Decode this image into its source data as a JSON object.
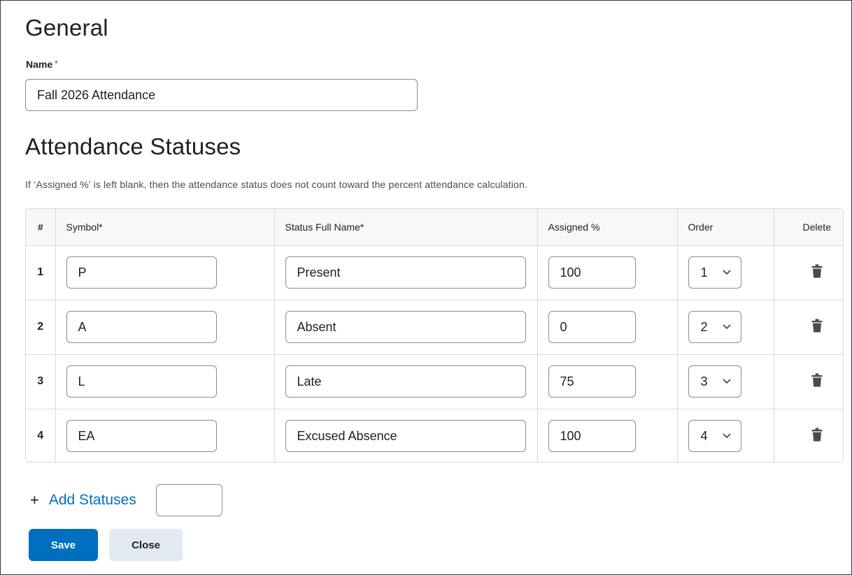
{
  "general": {
    "title": "General",
    "name_label": "Name",
    "required_mark": "*",
    "name_value": "Fall 2026 Attendance"
  },
  "statuses": {
    "title": "Attendance Statuses",
    "help_text": "If ‘Assigned %’ is left blank, then the attendance status does not count toward the percent attendance calculation.",
    "columns": {
      "num": "#",
      "symbol": "Symbol*",
      "full_name": "Status Full Name*",
      "assigned": "Assigned %",
      "order": "Order",
      "delete": "Delete"
    },
    "rows": [
      {
        "num": "1",
        "symbol": "P",
        "full_name": "Present",
        "assigned": "100",
        "order": "1"
      },
      {
        "num": "2",
        "symbol": "A",
        "full_name": "Absent",
        "assigned": "0",
        "order": "2"
      },
      {
        "num": "3",
        "symbol": "L",
        "full_name": "Late",
        "assigned": "75",
        "order": "3"
      },
      {
        "num": "4",
        "symbol": "EA",
        "full_name": "Excused Absence",
        "assigned": "100",
        "order": "4"
      }
    ]
  },
  "add": {
    "icon": "plus-icon",
    "plus_glyph": "+",
    "label": "Add Statuses",
    "count_value": ""
  },
  "buttons": {
    "save": "Save",
    "close": "Close"
  },
  "colors": {
    "primary": "#006fbf",
    "secondary_bg": "#e3e9f1",
    "header_bg": "#f7f8fa",
    "border": "#d6d9dc"
  }
}
